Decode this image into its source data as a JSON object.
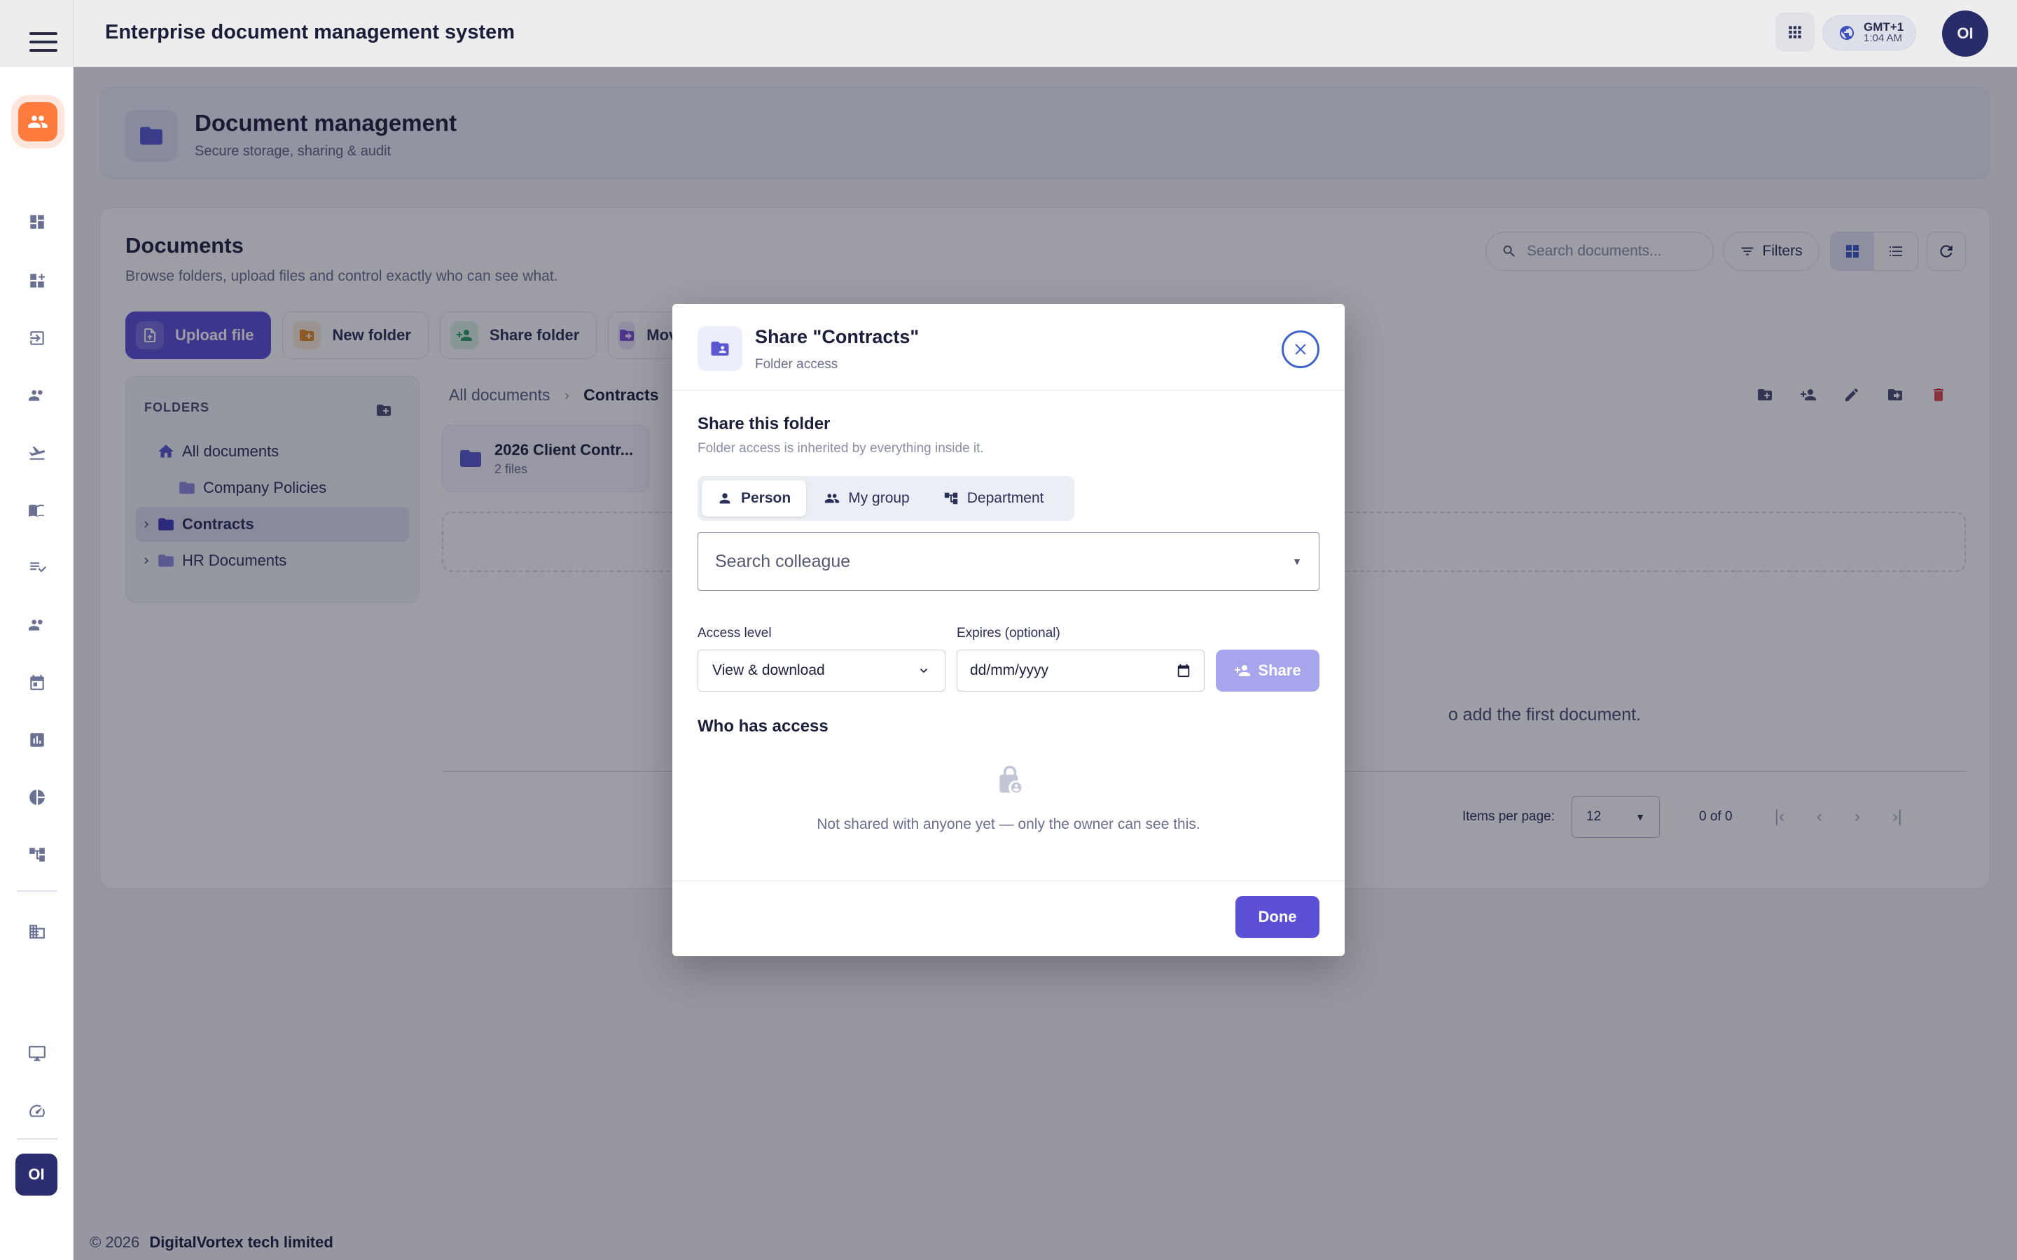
{
  "app": {
    "title": "Enterprise document management system",
    "timezone": "GMT+1",
    "time": "1:04 AM",
    "user_initials": "OI"
  },
  "hero": {
    "title": "Document management",
    "subtitle": "Secure storage, sharing & audit"
  },
  "documents": {
    "title": "Documents",
    "description": "Browse folders, upload files and control exactly who can see what.",
    "search_placeholder": "Search documents...",
    "filters_label": "Filters",
    "actions": [
      "Upload file",
      "New folder",
      "Share folder",
      "Mov"
    ],
    "folders_label": "FOLDERS",
    "tree": [
      {
        "label": "All documents"
      },
      {
        "label": "Company Policies"
      },
      {
        "label": "Contracts"
      },
      {
        "label": "HR Documents"
      }
    ],
    "breadcrumb": [
      "All documents",
      "Contracts"
    ],
    "card": {
      "name": "2026 Client Contr...",
      "meta": "2 files"
    },
    "empty_text": "o add the first document.",
    "items_per_page_label": "Items per page:",
    "items_per_page": "12",
    "range": "0 of 0"
  },
  "footer": {
    "copyright": "© 2026",
    "company": "DigitalVortex tech limited"
  },
  "modal": {
    "title": "Share \"Contracts\"",
    "subtitle": "Folder access",
    "section_title": "Share this folder",
    "section_desc": "Folder access is inherited by everything inside it.",
    "tabs": [
      "Person",
      "My group",
      "Department"
    ],
    "active_tab": "Person",
    "search_placeholder": "Search colleague",
    "access_label": "Access level",
    "access_value": "View & download",
    "expires_label": "Expires (optional)",
    "expires_placeholder": "dd/mm/yyyy",
    "share_label": "Share",
    "who_title": "Who has access",
    "empty_msg": "Not shared with anyone yet — only the owner can see this.",
    "done_label": "Done"
  },
  "colors": {
    "primary": "#5b4fd6",
    "brand_orange": "#ff7a3d",
    "folder": "#5b57d0",
    "danger": "#e0464f"
  }
}
